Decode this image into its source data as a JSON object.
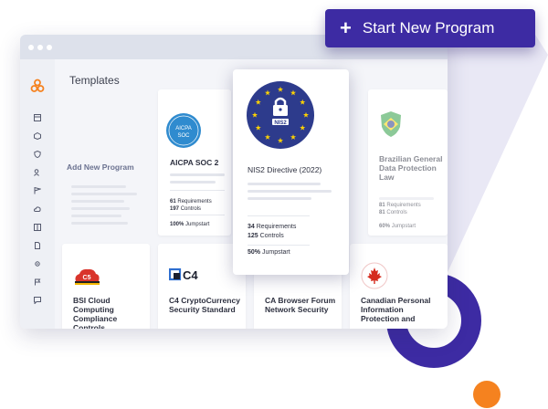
{
  "page": {
    "heading": "Templates"
  },
  "start_button": {
    "label": "Start New Program",
    "icon": "plus-icon"
  },
  "colors": {
    "brand": "#3d2ba3",
    "accent_orange": "#f5821f",
    "eu_blue": "#2d3b8c",
    "eu_star": "#ffd200"
  },
  "sidebar": {
    "icons": [
      "logo-icon",
      "dashboard-icon",
      "box-icon",
      "shield-icon",
      "users-icon",
      "flag-icon",
      "cloud-icon",
      "table-icon",
      "document-icon",
      "settings-icon",
      "report-icon",
      "chat-icon"
    ]
  },
  "templates": {
    "add": {
      "title": "Add New Program"
    },
    "aicpa": {
      "title": "AICPA SOC 2",
      "logo_top": "AICPA",
      "logo_bottom": "SOC",
      "requirements": "61",
      "requirements_label": "Requirements",
      "controls": "197",
      "controls_label": "Controls",
      "jumpstart": "100%",
      "jumpstart_label": "Jumpstart"
    },
    "nis2": {
      "title": "NIS2 Directive (2022)",
      "badge": "NIS2",
      "requirements": "34",
      "requirements_label": "Requirements",
      "controls": "125",
      "controls_label": "Controls",
      "jumpstart": "50%",
      "jumpstart_label": "Jumpstart"
    },
    "brazil": {
      "title": "Brazilian General Data Protection Law",
      "requirements": "81",
      "requirements_label": "Requirements",
      "controls": "81",
      "controls_label": "Controls",
      "jumpstart": "60%",
      "jumpstart_label": "Jumpstart"
    },
    "bsi": {
      "title": "BSI Cloud Computing Compliance Controls",
      "logo": "C5"
    },
    "c4": {
      "title": "C4 CryptoCurrency Security Standard",
      "logo": "C4"
    },
    "cab": {
      "title": "CA Browser Forum Network Security"
    },
    "canada": {
      "title": "Canadian Personal Information Protection and"
    }
  }
}
